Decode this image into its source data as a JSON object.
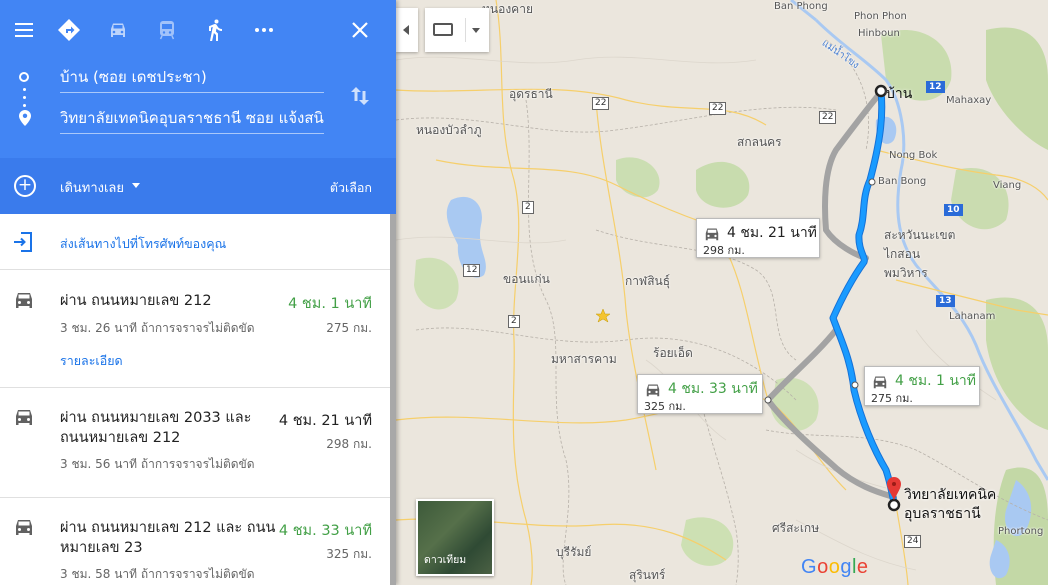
{
  "directions": {
    "modes": [
      "menu-icon",
      "directions-icon",
      "car-icon",
      "transit-icon",
      "walk-icon",
      "more-icon",
      "close-icon"
    ],
    "origin": "บ้าน (ซอย เดชประชา)",
    "destination": "วิทยาลัยเทคนิคอุบลราชธานี ซอย แจ้งสนิท"
  },
  "options": {
    "leave_now": "เดินทางเลย",
    "options_label": "ตัวเลือก"
  },
  "send_to_phone": "ส่งเส้นทางไปที่โทรศัพท์ของคุณ",
  "routes": [
    {
      "title": "ผ่าน ถนนหมายเลข 212",
      "time": "4 ชม. 1 นาที",
      "time_color": "#43a047",
      "distance": "275 กม.",
      "note": "3 ชม. 26 นาที ถ้าการจราจรไม่ติดขัด",
      "details": "รายละเอียด"
    },
    {
      "title": "ผ่าน ถนนหมายเลข 2033 และ ถนนหมายเลข 212",
      "time": "4 ชม. 21 นาที",
      "time_color": "#222222",
      "distance": "298 กม.",
      "note": "3 ชม. 56 นาที ถ้าการจราจรไม่ติดขัด"
    },
    {
      "title": "ผ่าน ถนนหมายเลข 212 และ ถนนหมายเลข 23",
      "time": "4 ชม. 33 นาที",
      "time_color": "#43a047",
      "distance": "325 กม.",
      "note": "3 ชม. 58 นาที ถ้าการจราจรไม่ติดขัด"
    }
  ],
  "map": {
    "places": {
      "ban_phong": "Ban Phong",
      "phon_phon": "Phon Phon",
      "hinboun": "Hinboun",
      "nong_khai": "หนองคาย",
      "mekong": "แม่น้ำโขง",
      "mahaxay": "Mahaxay",
      "udon": "อุดรธานี",
      "nong_bua": "หนองบัวลำภู",
      "sakon": "สกลนคร",
      "nong_bok": "Nong Bok",
      "ban_bong": "Ban Bong",
      "viang": "Viang",
      "savannakhet": "สะหวันนะเขต",
      "kaisone": "ไกสอน",
      "phomvihan": "พมวิหาร",
      "khon_kaen": "ขอนแก่น",
      "kalasin": "กาฬสินธุ์",
      "lahanam": "Lahanam",
      "maha_sarakham": "มหาสารคาม",
      "roi_et": "ร้อยเอ็ด",
      "sisaket": "ศรีสะเกษ",
      "buriram": "บุรีรัมย์",
      "surin": "สุรินทร์",
      "phortong": "Phortong"
    },
    "shields": {
      "s22a": "22",
      "s22b": "22",
      "s22c": "22",
      "s2a": "2",
      "s2b": "2",
      "s12": "12",
      "s10": "10",
      "s13": "13",
      "s12l": "12",
      "s24": "24"
    },
    "origin_label": "บ้าน",
    "destination_label_1": "วิทยาลัยเทคนิค",
    "destination_label_2": "อุบลราชธานี",
    "satellite_label": "ดาวเทียม",
    "google": "Google",
    "tips": [
      {
        "time": "4 ชม. 21 นาที",
        "distance": "298 กม.",
        "color": "#222222"
      },
      {
        "time": "4 ชม. 33 นาที",
        "distance": "325 กม.",
        "color": "#43a047"
      },
      {
        "time": "4 ชม. 1 นาที",
        "distance": "275 กม.",
        "color": "#43a047"
      }
    ],
    "colors": {
      "route_primary": "#1a9bff",
      "route_alt": "#9e9e9e",
      "header": "#4285f4",
      "accent_green": "#43a047"
    }
  }
}
